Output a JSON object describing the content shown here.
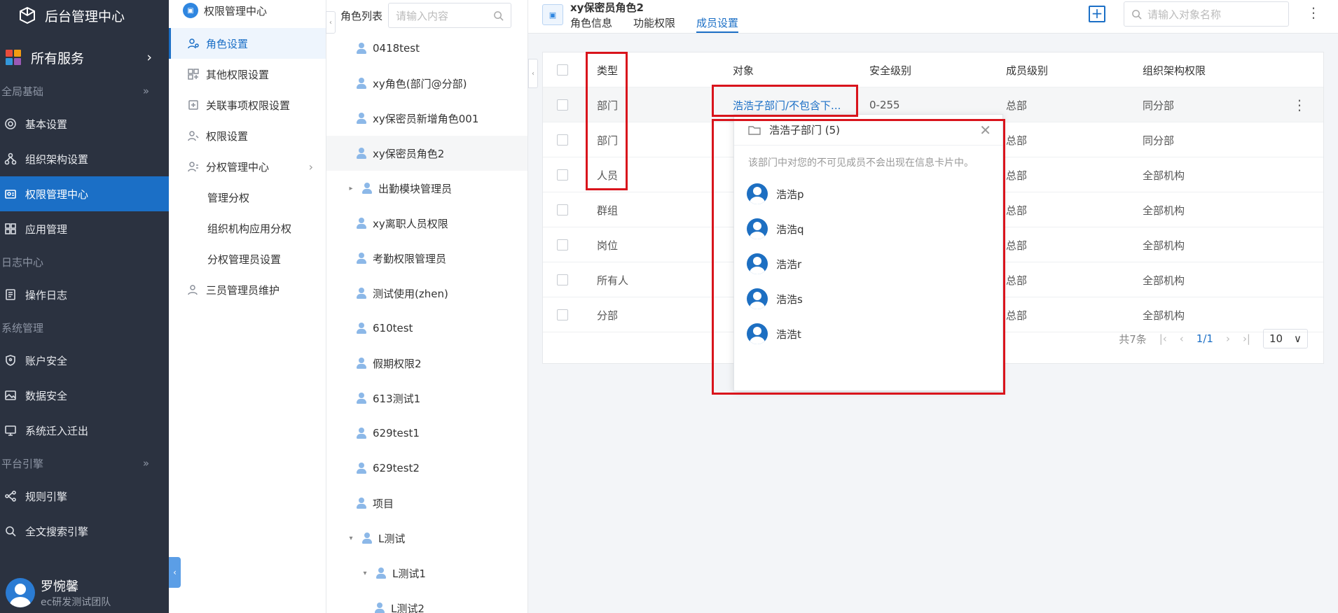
{
  "sidebar": {
    "brand": "后台管理中心",
    "all_services": "所有服务",
    "groups": [
      {
        "label": "全局基础",
        "items": [
          "基本设置",
          "组织架构设置",
          "权限管理中心",
          "应用管理"
        ]
      },
      {
        "label": "日志中心",
        "items": [
          "操作日志"
        ]
      },
      {
        "label": "系统管理",
        "items": [
          "账户安全",
          "数据安全",
          "系统迁入迁出"
        ]
      },
      {
        "label": "平台引擎",
        "items": [
          "规则引擎",
          "全文搜索引擎"
        ]
      }
    ],
    "active_item": "权限管理中心",
    "user": {
      "name": "罗惋馨",
      "team": "ec研发测试团队"
    }
  },
  "nav2": {
    "title": "权限管理中心",
    "items": [
      "角色设置",
      "其他权限设置",
      "关联事项权限设置",
      "权限设置",
      "分权管理中心"
    ],
    "sub_items": [
      "管理分权",
      "组织机构应用分权",
      "分权管理员设置"
    ],
    "last_item": "三员管理员维护"
  },
  "roles": {
    "title": "角色列表",
    "search_placeholder": "请输入内容",
    "items": [
      "0418test",
      "xy角色(部门@分部)",
      "xy保密员新增角色001",
      "xy保密员角色2",
      "出勤模块管理员",
      "xy离职人员权限",
      "考勤权限管理员",
      "测试使用(zhen)",
      "610test",
      "假期权限2",
      "613测试1",
      "629test1",
      "629test2",
      "项目",
      "L测试",
      "L测试1",
      "L测试2"
    ],
    "selected": "xy保密员角色2"
  },
  "main": {
    "title": "xy保密员角色2",
    "tabs": [
      "角色信息",
      "功能权限",
      "成员设置"
    ],
    "active_tab": "成员设置",
    "search_placeholder": "请输入对象名称",
    "table": {
      "headers": [
        "类型",
        "对象",
        "安全级别",
        "成员级别",
        "组织架构权限"
      ],
      "rows": [
        {
          "type": "部门",
          "obj": "浩浩子部门/不包含下...",
          "sec": "0-255",
          "mem": "总部",
          "org": "同分部"
        },
        {
          "type": "部门",
          "obj": "",
          "sec": "",
          "mem": "总部",
          "org": "同分部"
        },
        {
          "type": "人员",
          "obj": "",
          "sec": "",
          "mem": "总部",
          "org": "全部机构"
        },
        {
          "type": "群组",
          "obj": "",
          "sec": "",
          "mem": "总部",
          "org": "全部机构"
        },
        {
          "type": "岗位",
          "obj": "",
          "sec": "",
          "mem": "总部",
          "org": "全部机构"
        },
        {
          "type": "所有人",
          "obj": "",
          "sec": "",
          "mem": "总部",
          "org": "全部机构"
        },
        {
          "type": "分部",
          "obj": "",
          "sec": "",
          "mem": "总部",
          "org": "全部机构"
        }
      ]
    },
    "pager": {
      "total": "共7条",
      "page": "1/1",
      "size": "10"
    }
  },
  "popover": {
    "title": "浩浩子部门 (5)",
    "note": "该部门中对您的不可见成员不会出现在信息卡片中。",
    "members": [
      "浩浩p",
      "浩浩q",
      "浩浩r",
      "浩浩s",
      "浩浩t"
    ]
  },
  "colors": {
    "accent": "#1b6fc6",
    "sidebar_bg": "#2b3240",
    "annotation": "#d9141c"
  }
}
